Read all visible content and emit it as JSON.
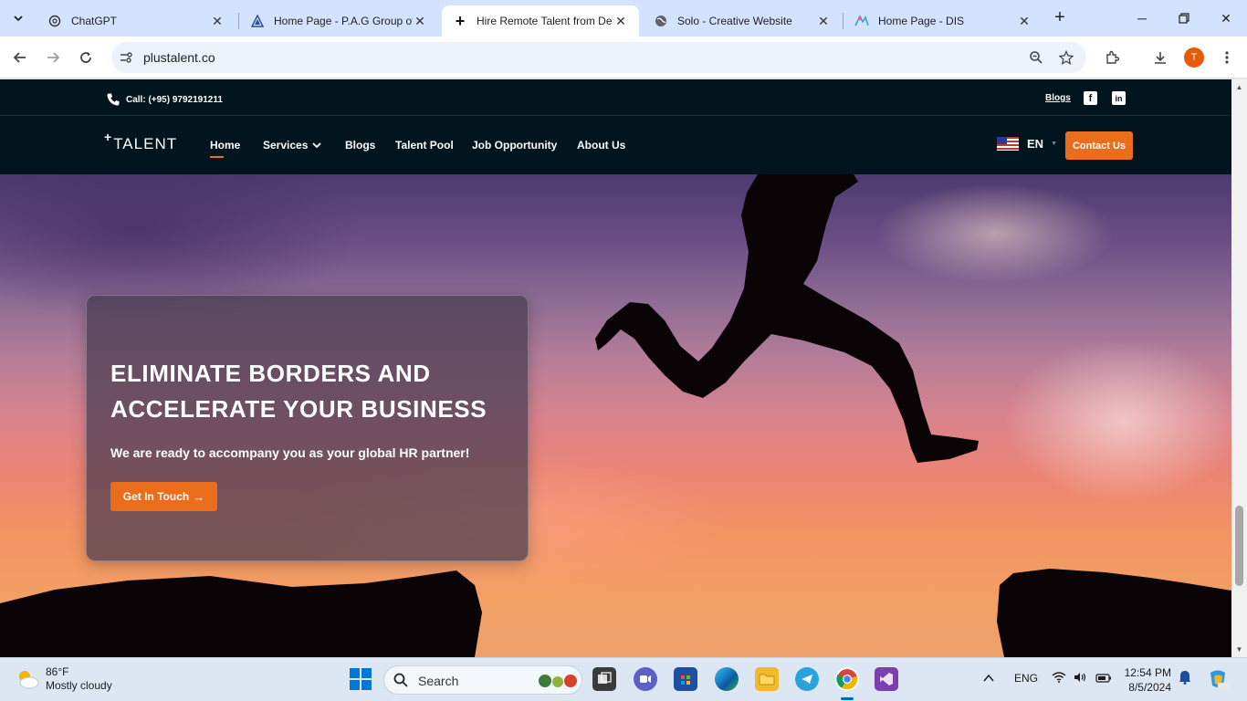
{
  "browser": {
    "tabs": [
      {
        "title": "ChatGPT",
        "icon": "chatgpt-icon"
      },
      {
        "title": "Home Page - P.A.G Group of",
        "icon": "pag-icon"
      },
      {
        "title": "Hire Remote Talent from De",
        "icon": "plustalent-icon",
        "active": true
      },
      {
        "title": "Solo - Creative Website",
        "icon": "globe-icon"
      },
      {
        "title": "Home Page - DIS",
        "icon": "dis-icon"
      }
    ],
    "url": "plustalent.co",
    "profile_initial": "T"
  },
  "site": {
    "topbar": {
      "phone": "Call: (+95) 9792191211",
      "blogs": "Blogs"
    },
    "logo_plus": "+",
    "logo_text": "TALENT",
    "nav": {
      "home": "Home",
      "services": "Services",
      "blogs": "Blogs",
      "talent_pool": "Talent Pool",
      "job_opportunity": "Job Opportunity",
      "about_us": "About Us"
    },
    "language": "EN",
    "contact_button": "Contact Us",
    "hero": {
      "heading_line1": "ELIMINATE BORDERS AND",
      "heading_line2": "ACCELERATE YOUR BUSINESS",
      "subheading": "We are ready to accompany you as your global HR partner!",
      "cta": "Get In Touch",
      "cta_arrow": "→"
    },
    "colors": {
      "brand_dark": "#02141d",
      "accent_orange": "#ea6d1c"
    }
  },
  "taskbar": {
    "weather_temp": "86°F",
    "weather_desc": "Mostly cloudy",
    "search_placeholder": "Search",
    "language": "ENG",
    "time": "12:54 PM",
    "date": "8/5/2024"
  }
}
